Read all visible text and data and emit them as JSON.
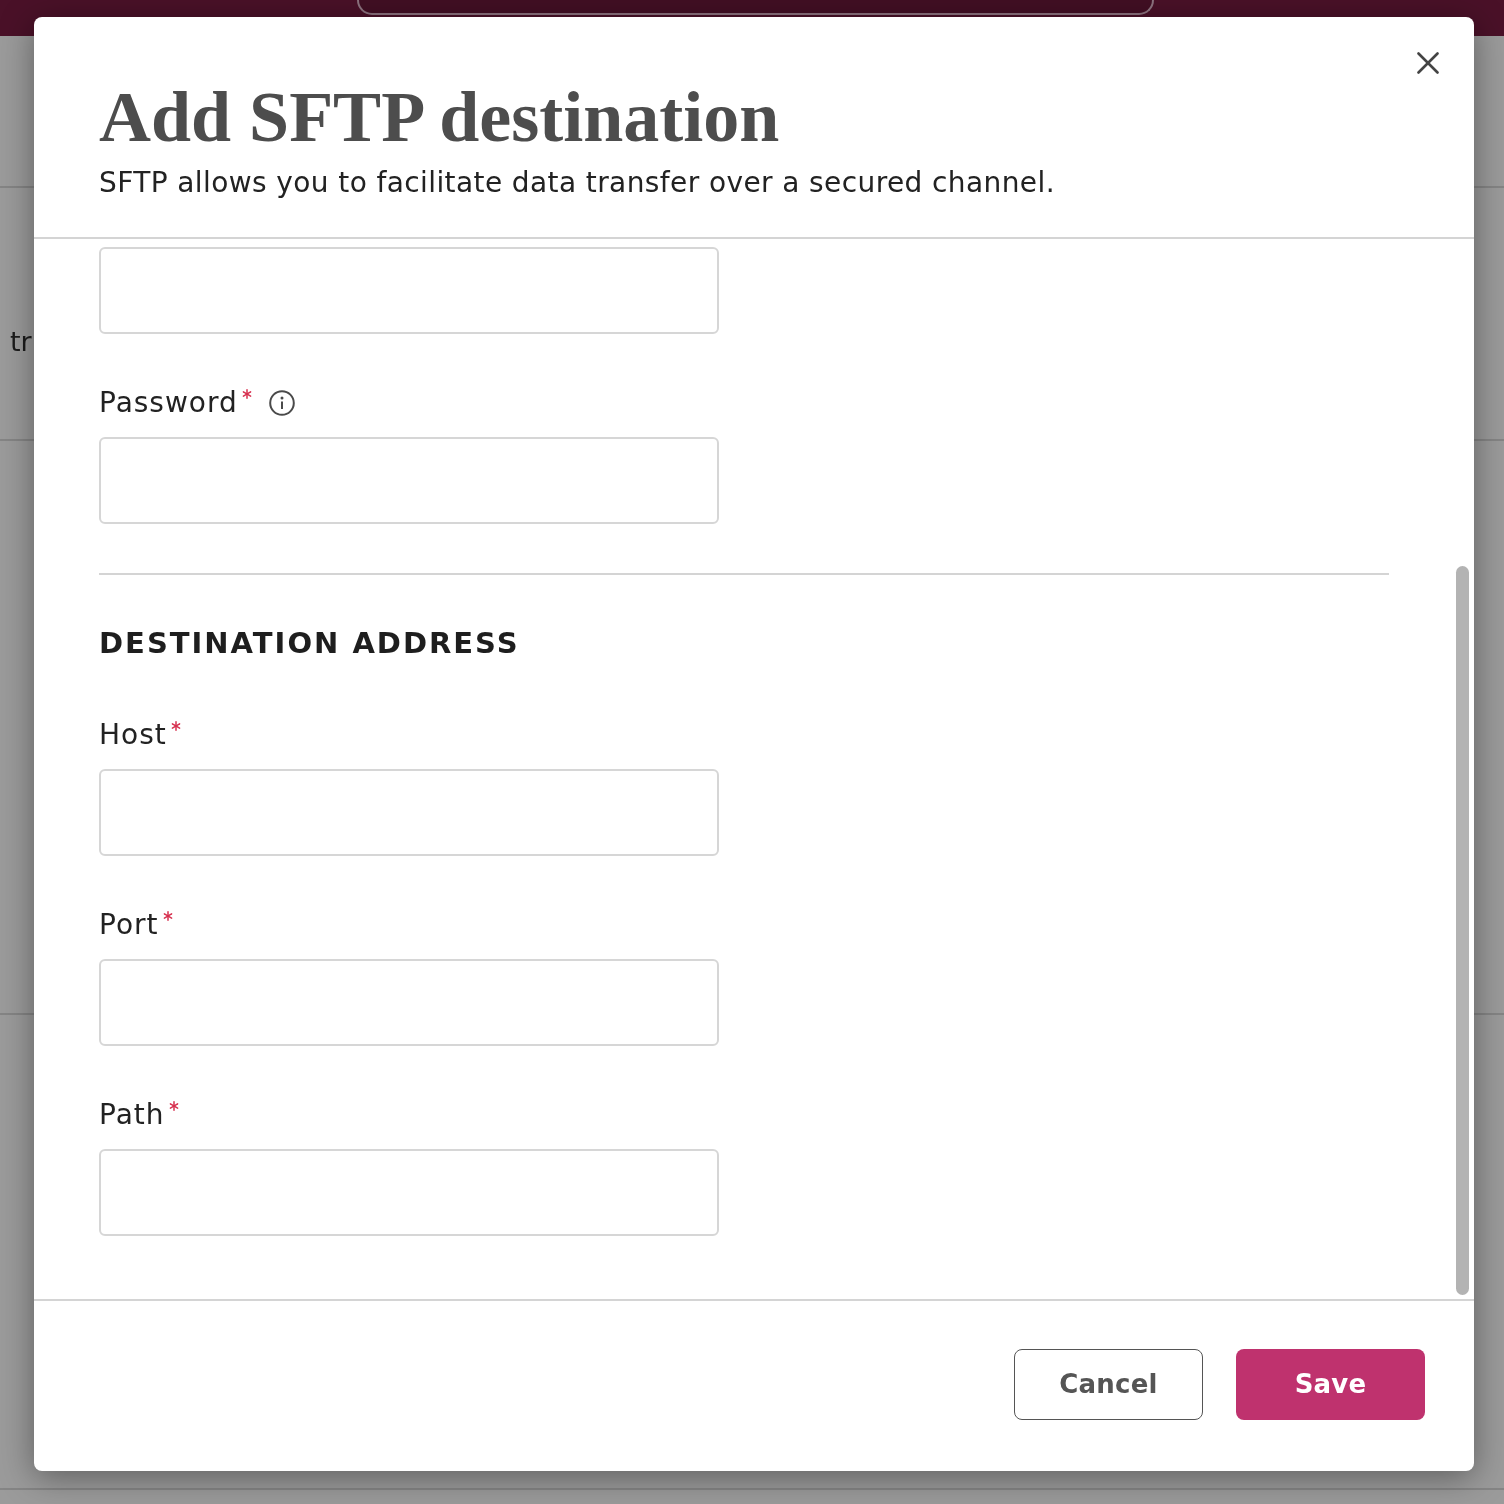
{
  "background": {
    "text_fragment": "tr"
  },
  "dialog": {
    "title": "Add SFTP destination",
    "subtitle": "SFTP allows you to facilitate data transfer over a secured channel."
  },
  "sections": [
    {
      "fields": [
        {
          "kind": "input"
        },
        {
          "kind": "input",
          "label": "Password",
          "required": true,
          "info": true
        }
      ]
    },
    {
      "heading": "DESTINATION ADDRESS",
      "fields": [
        {
          "kind": "input",
          "label": "Host",
          "required": true,
          "info": false
        },
        {
          "kind": "input",
          "label": "Port",
          "required": true,
          "info": false
        },
        {
          "kind": "input",
          "label": "Path",
          "required": true,
          "info": false
        }
      ]
    }
  ],
  "buttons": [
    {
      "label": "Cancel",
      "kind": "secondary"
    },
    {
      "label": "Save",
      "kind": "primary"
    }
  ]
}
